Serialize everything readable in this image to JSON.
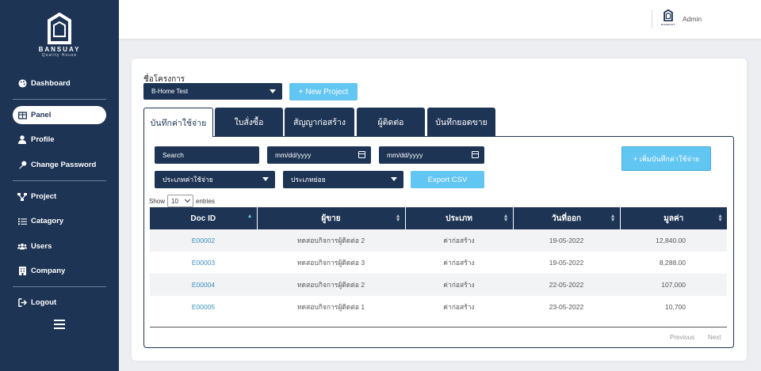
{
  "brand": {
    "name": "BANSUAY",
    "tagline": "Quality House"
  },
  "sidebar": {
    "items": [
      {
        "label": "Dashboard",
        "icon": "palette-icon"
      },
      {
        "label": "Panel",
        "icon": "panel-icon"
      },
      {
        "label": "Profile",
        "icon": "user-icon"
      },
      {
        "label": "Change Password",
        "icon": "key-icon"
      },
      {
        "label": "Project",
        "icon": "project-icon"
      },
      {
        "label": "Catagory",
        "icon": "list-icon"
      },
      {
        "label": "Users",
        "icon": "users-icon"
      },
      {
        "label": "Company",
        "icon": "building-icon"
      },
      {
        "label": "Logout",
        "icon": "logout-icon"
      }
    ],
    "active": "Panel"
  },
  "topbar": {
    "user": "Admin",
    "mini_brand": "BANSUAY"
  },
  "project": {
    "label": "ชื่อโครงการ",
    "selected": "B-Home Test",
    "new_button": "+ New Project"
  },
  "tabs": [
    "บันทึกค่าใช้จ่าย",
    "ใบสั่งซื้อ",
    "สัญญาก่อสร้าง",
    "ผู้ติดต่อ",
    "บันทึกยอดขาย"
  ],
  "filters": {
    "search": "Search",
    "date_from": "mm/dd/yyyy",
    "date_to": "mm/dd/yyyy",
    "type": "ประเภทค่าใช้จ่าย",
    "subtype": "ประเภทย่อย",
    "export": "Export CSV",
    "add": "+ เพิ่มบันทึกค่าใช้จ่าย"
  },
  "entries": {
    "show": "Show",
    "value": "10",
    "suffix": "entries"
  },
  "table": {
    "headers": [
      "Doc ID",
      "ผู้ขาย",
      "ประเภท",
      "วันที่ออก",
      "มูลค่า"
    ],
    "rows": [
      [
        "E00002",
        "ทดสอบกิจการผู้ติดต่อ 2",
        "ค่าก่อสร้าง",
        "19-05-2022",
        "12,840.00"
      ],
      [
        "E00003",
        "ทดสอบกิจการผู้ติดต่อ 3",
        "ค่าก่อสร้าง",
        "19-05-2022",
        "8,288.00"
      ],
      [
        "E00004",
        "ทดสอบกิจการผู้ติดต่อ 2",
        "ค่าก่อสร้าง",
        "22-05-2022",
        "107,000"
      ],
      [
        "E00005",
        "ทดสอบกิจการผู้ติดต่อ 1",
        "ค่าก่อสร้าง",
        "23-05-2022",
        "10,700"
      ]
    ]
  },
  "pager": {
    "previous": "Previous",
    "next": "Next"
  }
}
